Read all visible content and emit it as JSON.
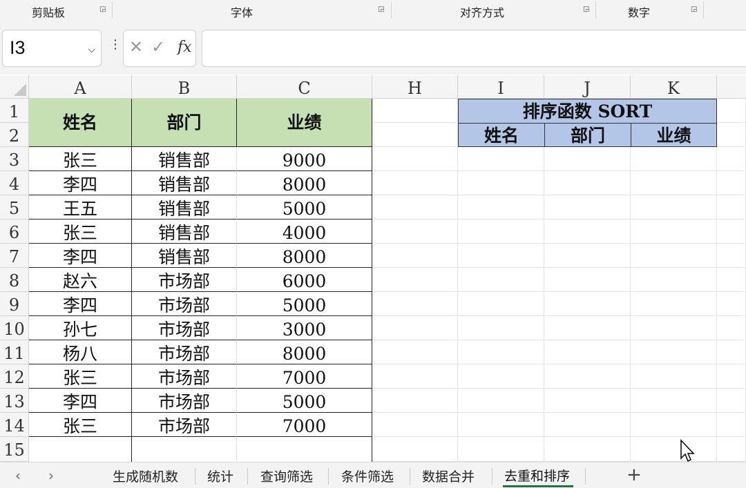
{
  "ribbon": {
    "groups": [
      "剪贴板",
      "字体",
      "对齐方式",
      "数字"
    ]
  },
  "formula_bar": {
    "name_box": "I3",
    "formula": "",
    "fx_label": "fx"
  },
  "grid": {
    "columns": [
      "A",
      "B",
      "C",
      "H",
      "I",
      "J",
      "K"
    ],
    "rows": [
      "1",
      "2",
      "3",
      "4",
      "5",
      "6",
      "7",
      "8",
      "9",
      "10",
      "11",
      "12",
      "13",
      "14",
      "15"
    ],
    "table_headers": [
      "姓名",
      "部门",
      "业绩"
    ],
    "table_rows": [
      [
        "张三",
        "销售部",
        "9000"
      ],
      [
        "李四",
        "销售部",
        "8000"
      ],
      [
        "王五",
        "销售部",
        "5000"
      ],
      [
        "张三",
        "销售部",
        "4000"
      ],
      [
        "李四",
        "销售部",
        "8000"
      ],
      [
        "赵六",
        "市场部",
        "6000"
      ],
      [
        "李四",
        "市场部",
        "5000"
      ],
      [
        "孙七",
        "市场部",
        "3000"
      ],
      [
        "杨八",
        "市场部",
        "8000"
      ],
      [
        "张三",
        "市场部",
        "7000"
      ],
      [
        "李四",
        "市场部",
        "5000"
      ],
      [
        "张三",
        "市场部",
        "7000"
      ]
    ],
    "sort_block": {
      "title": "排序函数 SORT",
      "headers": [
        "姓名",
        "部门",
        "业绩"
      ]
    },
    "colors": {
      "table_header_fill": "#c6e0b4",
      "sort_header_fill": "#b4c6e7"
    }
  },
  "sheet_tabs": {
    "tabs": [
      "生成随机数",
      "统计",
      "查询筛选",
      "条件筛选",
      "数据合并",
      "去重和排序"
    ],
    "active": "去重和排序",
    "accent": "#1e7145"
  }
}
